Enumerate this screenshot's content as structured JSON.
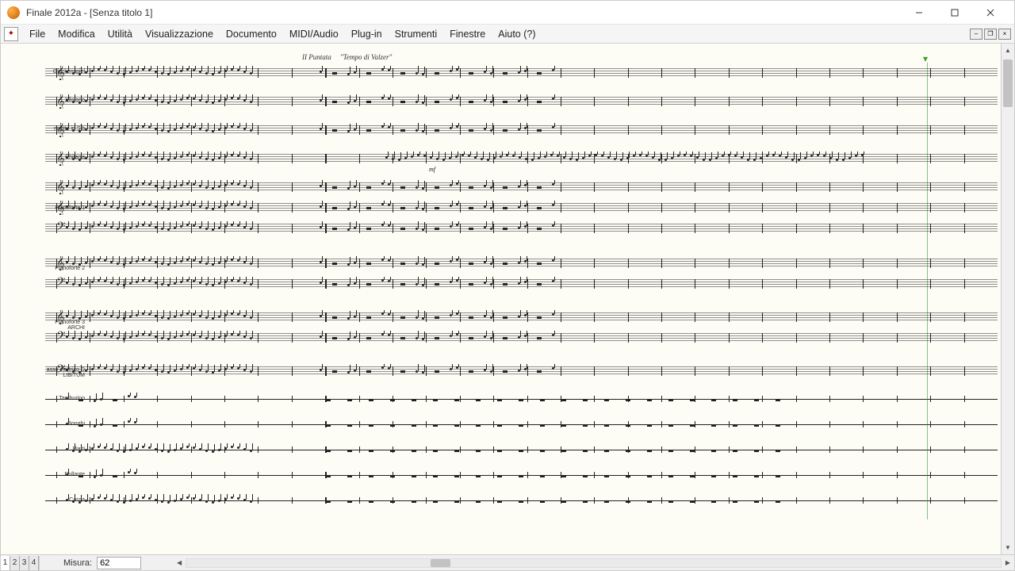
{
  "window": {
    "title": "Finale 2012a - [Senza titolo 1]"
  },
  "menu": {
    "items": [
      "File",
      "Modifica",
      "Utilità",
      "Visualizzazione",
      "Documento",
      "MIDI/Audio",
      "Plug-in",
      "Strumenti",
      "Finestre",
      "Aiuto (?)"
    ]
  },
  "score": {
    "header_left": "II Puntata",
    "header_right": "\"Tempo di Valzer\"",
    "dynamic": "mf",
    "playhead_measure": 62,
    "instruments": [
      {
        "label": "Glockenspiel",
        "clef": "𝄞",
        "type": "single",
        "dense": true
      },
      {
        "label": "Xilofono",
        "clef": "𝄞",
        "type": "single",
        "dense": true
      },
      {
        "label": "rinetto in Sib",
        "clef": "𝄞",
        "type": "single",
        "dense": true
      },
      {
        "label": "Chitarra",
        "clef": "𝄞",
        "type": "single",
        "dense": true,
        "ties": true
      },
      {
        "label": "Pianoforte 1",
        "clef": "𝄞",
        "type": "grand3",
        "dense": true
      },
      {
        "label": "Pianoforte 2",
        "clef": "𝄞",
        "type": "grand",
        "dense": true
      },
      {
        "label": "Pianoforte 3 ARCHI",
        "clef": "𝄞",
        "type": "grand",
        "dense": true
      },
      {
        "label": "asso elettrico D LIBITUM",
        "clef": "𝄢",
        "type": "single",
        "dense": true
      },
      {
        "label": "Tamburino",
        "clef": "",
        "type": "perc",
        "dense": false
      },
      {
        "label": "Bonghi",
        "clef": "",
        "type": "perc",
        "dense": false
      },
      {
        "label": "Piatti",
        "clef": "",
        "type": "perc",
        "dense": true
      },
      {
        "label": "Rullante",
        "clef": "",
        "type": "perc",
        "dense": false
      },
      {
        "label": "Cassa",
        "clef": "",
        "type": "perc",
        "dense": true
      }
    ],
    "measures_visible": 28,
    "double_bar_at": 8
  },
  "bottom": {
    "pages": [
      "1",
      "2",
      "3",
      "4"
    ],
    "active_page": 0,
    "measure_label": "Misura:",
    "measure_value": "62"
  },
  "colors": {
    "paper": "#fdfcf5",
    "ink": "#222222",
    "playhead": "#3a9d23"
  }
}
